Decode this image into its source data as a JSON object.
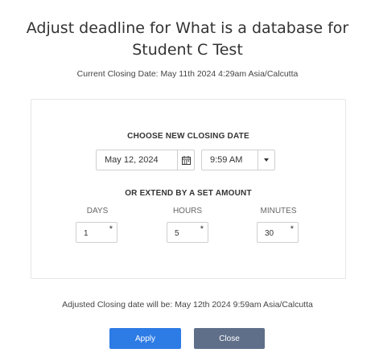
{
  "dialog": {
    "title": "Adjust deadline for What is a database for Student C Test",
    "current_closing": "Current Closing Date: May 11th 2024 4:29am Asia/Calcutta"
  },
  "new_closing": {
    "heading": "CHOOSE NEW CLOSING DATE",
    "date_value": "May 12, 2024",
    "date_icon": "calendar-icon",
    "time_value": "9:59 AM",
    "time_icon": "chevron-down-icon"
  },
  "extend": {
    "heading": "OR EXTEND BY A SET AMOUNT",
    "days_label": "DAYS",
    "days_value": "1",
    "hours_label": "HOURS",
    "hours_value": "5",
    "minutes_label": "MINUTES",
    "minutes_value": "30",
    "required_mark": "*"
  },
  "adjusted_text": "Adjusted Closing date will be: May 12th 2024 9:59am Asia/Calcutta",
  "buttons": {
    "apply": "Apply",
    "close": "Close"
  },
  "colors": {
    "apply": "#2d7be5",
    "close": "#5f6f8a"
  }
}
